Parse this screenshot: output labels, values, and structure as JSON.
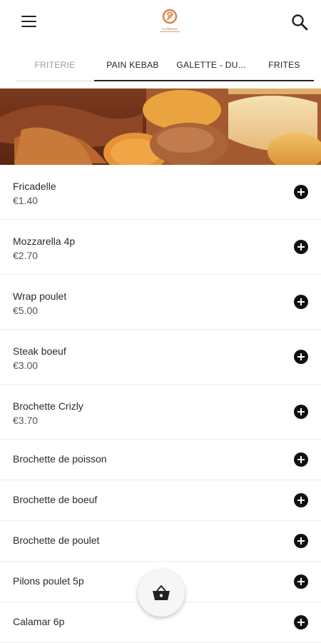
{
  "header": {
    "menu_icon": "hamburger-menu-icon",
    "logo_text": "La Maison",
    "search_icon": "search-icon"
  },
  "tabs": [
    {
      "label": "FRITERIE",
      "active": false
    },
    {
      "label": "PAIN KEBAB",
      "active": true
    },
    {
      "label": "GALETTE - DU...",
      "active": true
    },
    {
      "label": "FRITES",
      "active": true
    }
  ],
  "banner": {
    "description_icon": "food-banner-image"
  },
  "items": [
    {
      "name": "Fricadelle",
      "price": "€1.40"
    },
    {
      "name": "Mozzarella 4p",
      "price": "€2.70"
    },
    {
      "name": "Wrap poulet",
      "price": "€5.00"
    },
    {
      "name": "Steak boeuf",
      "price": "€3.00"
    },
    {
      "name": "Brochette Crizly",
      "price": "€3.70"
    },
    {
      "name": "Brochette de poisson"
    },
    {
      "name": "Brochette de boeuf"
    },
    {
      "name": "Brochette de poulet"
    },
    {
      "name": "Pilons poulet 5p"
    },
    {
      "name": "Calamar 6p"
    }
  ],
  "colors": {
    "accent": "#222222",
    "logo": "#d9844a"
  },
  "basket": {
    "icon": "basket-icon"
  }
}
